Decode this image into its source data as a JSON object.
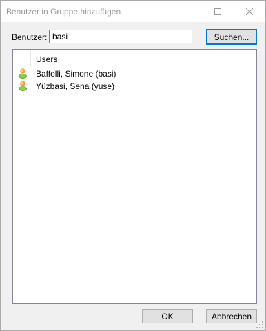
{
  "window": {
    "title": "Benutzer in Gruppe hinzufügen"
  },
  "titlebar_icons": [
    "minimize-icon",
    "maximize-icon",
    "close-icon"
  ],
  "search": {
    "label": "Benutzer:",
    "value": "basi",
    "button_label": "Suchen..."
  },
  "results": {
    "column_header": "Users",
    "row_icon": "user-icon",
    "rows": [
      {
        "name": "Baffelli, Simone (basi)"
      },
      {
        "name": "Yüzbasi, Sena (yuse)"
      }
    ]
  },
  "footer": {
    "ok_label": "OK",
    "cancel_label": "Abbrechen"
  },
  "colors": {
    "dialog_background": "#f0f0f0",
    "focus_border": "#0078d7",
    "title_text": "#999999"
  }
}
